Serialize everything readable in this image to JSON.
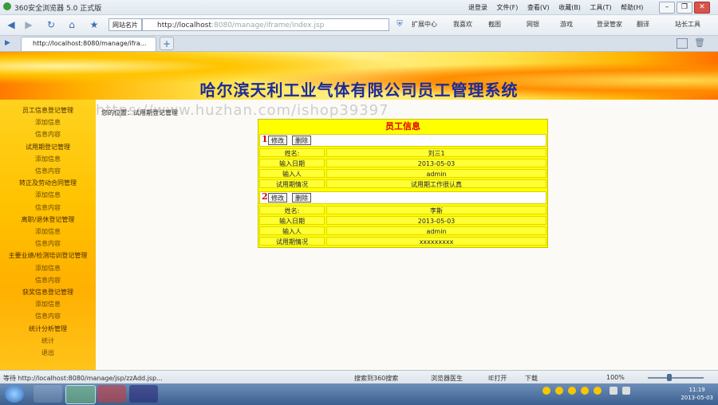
{
  "browser": {
    "title": "360安全浏览器 5.0 正式版",
    "menu": [
      "退登录",
      "文件(F)",
      "查看(V)",
      "收藏(B)",
      "工具(T)",
      "帮助(H)"
    ],
    "window_controls": [
      "☐",
      "–",
      "❐",
      "✕"
    ],
    "favorites_label": "网站名片",
    "address": "http://localhost:8080/manage/iframe/index.jsp",
    "address_host": "http://localhost",
    "address_rest": ":8080/manage/iframe/index.jsp",
    "tools": [
      "扩展中心",
      "我喜欢",
      "截图",
      "网银",
      "游戏",
      "登录管家",
      "翻译",
      "站长工具"
    ],
    "tab_label": "http://localhost:8080/manage/ifra...",
    "new_tab": "+"
  },
  "page": {
    "banner_title": "哈尔滨天利工业气体有限公司员工管理系统",
    "breadcrumb": "您的位置：试用期登记管理",
    "watermark": "https://www.huzhan.com/ishop39397",
    "sidebar": [
      {
        "label": "员工信息登记管理",
        "type": "h"
      },
      {
        "label": "添加信息",
        "type": "s"
      },
      {
        "label": "信息内容",
        "type": "s"
      },
      {
        "label": "试用期登记管理",
        "type": "h"
      },
      {
        "label": "添加信息",
        "type": "s"
      },
      {
        "label": "信息内容",
        "type": "s"
      },
      {
        "label": "转正及劳动合同管理",
        "type": "h"
      },
      {
        "label": "添加信息",
        "type": "s"
      },
      {
        "label": "信息内容",
        "type": "s"
      },
      {
        "label": "离职/退休登记管理",
        "type": "h"
      },
      {
        "label": "添加信息",
        "type": "s"
      },
      {
        "label": "信息内容",
        "type": "s"
      },
      {
        "label": "主要业绩/检测培训登记管理",
        "type": "h"
      },
      {
        "label": "添加信息",
        "type": "s"
      },
      {
        "label": "信息内容",
        "type": "s"
      },
      {
        "label": "获奖信息登记管理",
        "type": "h"
      },
      {
        "label": "添加信息",
        "type": "s"
      },
      {
        "label": "信息内容",
        "type": "s"
      },
      {
        "label": "统计分析管理",
        "type": "h"
      },
      {
        "label": "统计",
        "type": "s"
      },
      {
        "label": "退出",
        "type": "s"
      }
    ],
    "panel": {
      "title": "员工信息",
      "edit_label": "修改",
      "delete_label": "删除",
      "records": [
        {
          "index": "1",
          "fields": [
            {
              "k": "姓名:",
              "v": "刘三1"
            },
            {
              "k": "输入日期",
              "v": "2013-05-03"
            },
            {
              "k": "输入人",
              "v": "admin"
            },
            {
              "k": "试用期情况",
              "v": "试用期工作很认真"
            }
          ]
        },
        {
          "index": "2",
          "fields": [
            {
              "k": "姓名:",
              "v": "李斯"
            },
            {
              "k": "输入日期",
              "v": "2013-05-03"
            },
            {
              "k": "输入人",
              "v": "admin"
            },
            {
              "k": "试用期情况",
              "v": "xxxxxxxxx"
            }
          ]
        }
      ]
    }
  },
  "statusbar": {
    "left": "等待 http://localhost:8080/manage/jsp/zzAdd.jsp...",
    "search": "搜索到360搜索",
    "block": "浏览器医生",
    "open": "IE打开",
    "download": "下载",
    "zoom": "100%"
  },
  "taskbar": {
    "time": "11:19",
    "date": "2013-05-03"
  },
  "colors": {
    "banner_title": "#1b2a9a",
    "panel_bg": "#ffff00",
    "panel_title": "#e00000"
  }
}
